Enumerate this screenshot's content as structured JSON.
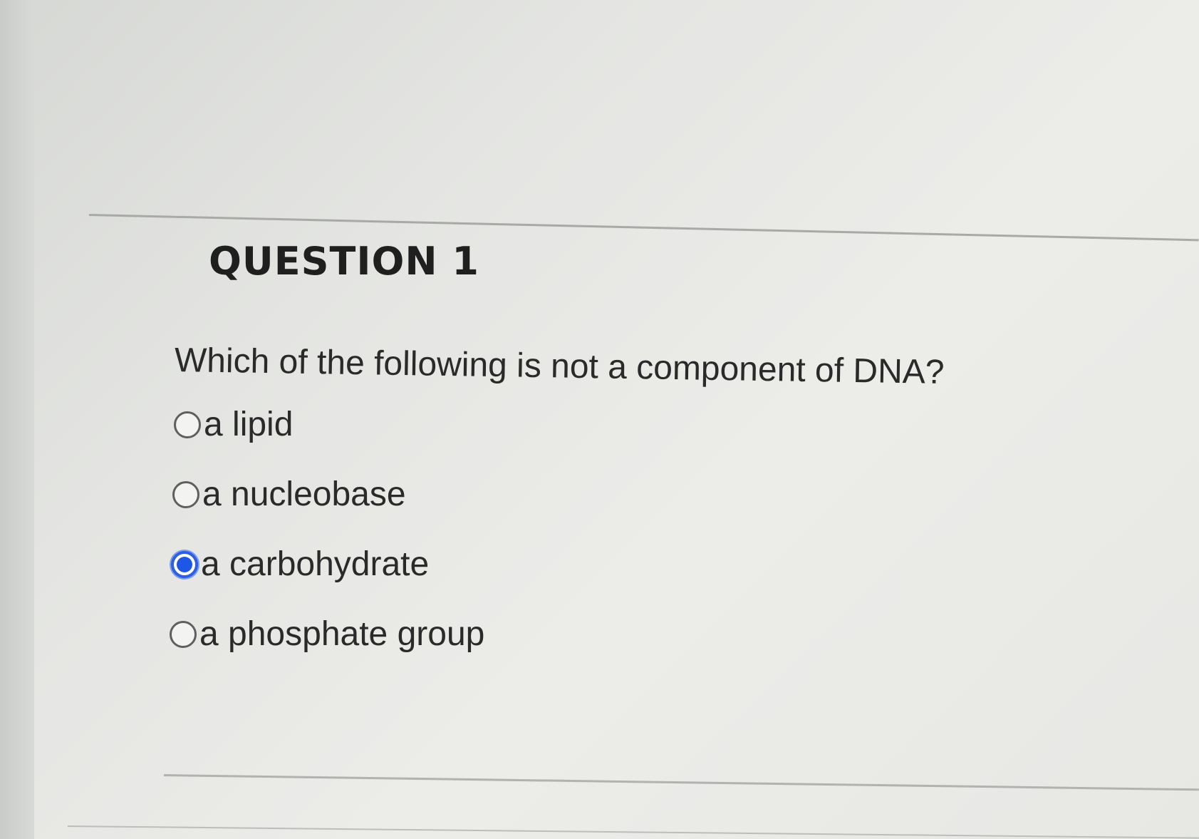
{
  "question": {
    "title": "QUESTION 1",
    "prompt": "Which of the following is not a component of DNA?",
    "options": [
      {
        "label": "a lipid",
        "selected": false
      },
      {
        "label": "a nucleobase",
        "selected": false
      },
      {
        "label": "a carbohydrate",
        "selected": true
      },
      {
        "label": "a phosphate group",
        "selected": false
      }
    ]
  },
  "colors": {
    "selected_radio": "#1e56e6",
    "text": "#2a2a2a",
    "background": "#e4e5e2"
  }
}
